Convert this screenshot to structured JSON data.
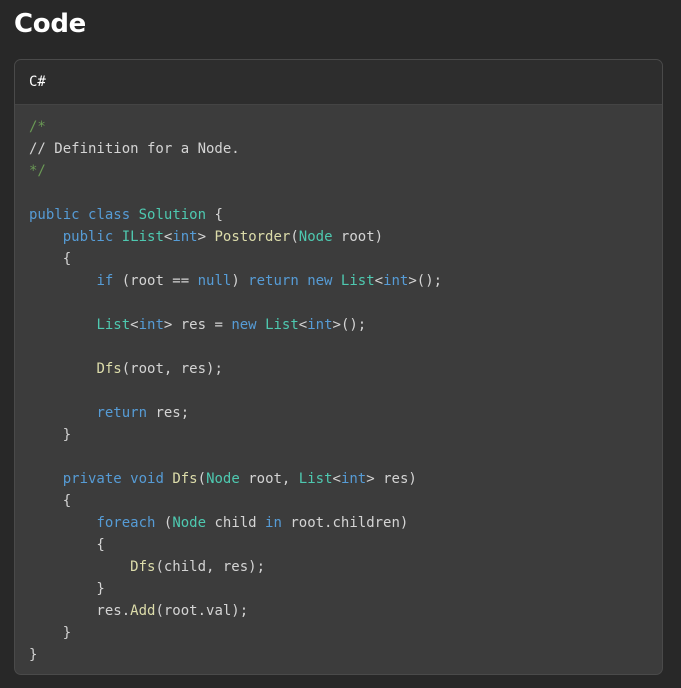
{
  "page": {
    "title": "Code"
  },
  "code_block": {
    "language": "C#",
    "colors": {
      "comment": "#6a9955",
      "text": "#d4d4d4",
      "keyword": "#569cd6",
      "type": "#4ec9b0",
      "function": "#dcdcaa"
    },
    "lines": [
      [
        [
          "comment",
          "/*"
        ]
      ],
      [
        [
          "text",
          "// Definition for a Node."
        ]
      ],
      [
        [
          "comment",
          "*/"
        ]
      ],
      [],
      [
        [
          "keyword",
          "public"
        ],
        [
          "text",
          " "
        ],
        [
          "keyword",
          "class"
        ],
        [
          "text",
          " "
        ],
        [
          "type",
          "Solution"
        ],
        [
          "text",
          " {"
        ]
      ],
      [
        [
          "text",
          "    "
        ],
        [
          "keyword",
          "public"
        ],
        [
          "text",
          " "
        ],
        [
          "type",
          "IList"
        ],
        [
          "text",
          "<"
        ],
        [
          "keyword",
          "int"
        ],
        [
          "text",
          "> "
        ],
        [
          "function",
          "Postorder"
        ],
        [
          "text",
          "("
        ],
        [
          "type",
          "Node"
        ],
        [
          "text",
          " root)"
        ]
      ],
      [
        [
          "text",
          "    {"
        ]
      ],
      [
        [
          "text",
          "        "
        ],
        [
          "keyword",
          "if"
        ],
        [
          "text",
          " (root == "
        ],
        [
          "keyword",
          "null"
        ],
        [
          "text",
          ") "
        ],
        [
          "keyword",
          "return"
        ],
        [
          "text",
          " "
        ],
        [
          "keyword",
          "new"
        ],
        [
          "text",
          " "
        ],
        [
          "type",
          "List"
        ],
        [
          "text",
          "<"
        ],
        [
          "keyword",
          "int"
        ],
        [
          "text",
          ">();"
        ]
      ],
      [],
      [
        [
          "text",
          "        "
        ],
        [
          "type",
          "List"
        ],
        [
          "text",
          "<"
        ],
        [
          "keyword",
          "int"
        ],
        [
          "text",
          "> res = "
        ],
        [
          "keyword",
          "new"
        ],
        [
          "text",
          " "
        ],
        [
          "type",
          "List"
        ],
        [
          "text",
          "<"
        ],
        [
          "keyword",
          "int"
        ],
        [
          "text",
          ">();"
        ]
      ],
      [],
      [
        [
          "text",
          "        "
        ],
        [
          "function",
          "Dfs"
        ],
        [
          "text",
          "(root, res);"
        ]
      ],
      [],
      [
        [
          "text",
          "        "
        ],
        [
          "keyword",
          "return"
        ],
        [
          "text",
          " res;"
        ]
      ],
      [
        [
          "text",
          "    }"
        ]
      ],
      [],
      [
        [
          "text",
          "    "
        ],
        [
          "keyword",
          "private"
        ],
        [
          "text",
          " "
        ],
        [
          "keyword",
          "void"
        ],
        [
          "text",
          " "
        ],
        [
          "function",
          "Dfs"
        ],
        [
          "text",
          "("
        ],
        [
          "type",
          "Node"
        ],
        [
          "text",
          " root, "
        ],
        [
          "type",
          "List"
        ],
        [
          "text",
          "<"
        ],
        [
          "keyword",
          "int"
        ],
        [
          "text",
          "> res)"
        ]
      ],
      [
        [
          "text",
          "    {"
        ]
      ],
      [
        [
          "text",
          "        "
        ],
        [
          "keyword",
          "foreach"
        ],
        [
          "text",
          " ("
        ],
        [
          "type",
          "Node"
        ],
        [
          "text",
          " child "
        ],
        [
          "keyword",
          "in"
        ],
        [
          "text",
          " root.children)"
        ]
      ],
      [
        [
          "text",
          "        {"
        ]
      ],
      [
        [
          "text",
          "            "
        ],
        [
          "function",
          "Dfs"
        ],
        [
          "text",
          "(child, res);"
        ]
      ],
      [
        [
          "text",
          "        }"
        ]
      ],
      [
        [
          "text",
          "        res."
        ],
        [
          "function",
          "Add"
        ],
        [
          "text",
          "(root.val);"
        ]
      ],
      [
        [
          "text",
          "    }"
        ]
      ],
      [
        [
          "text",
          "}"
        ]
      ]
    ]
  }
}
